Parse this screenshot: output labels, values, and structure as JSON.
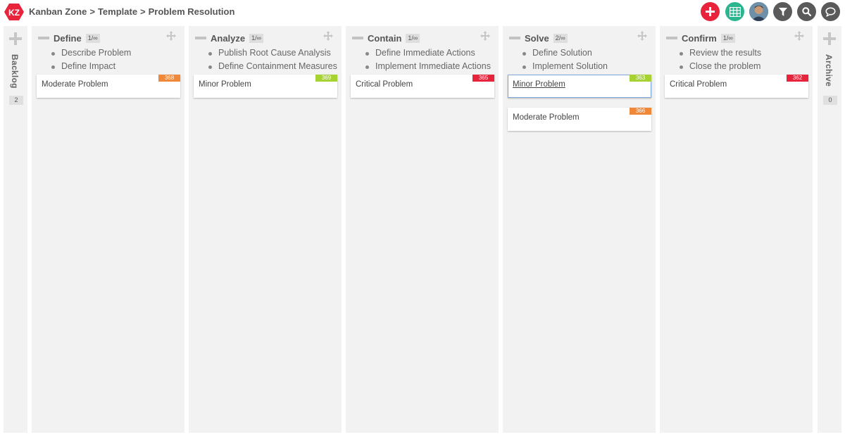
{
  "header": {
    "logo_text": "KZ",
    "breadcrumb": [
      "Kanban Zone",
      "Template",
      "Problem Resolution"
    ],
    "separator": ">",
    "buttons": [
      {
        "name": "add-card-button",
        "icon": "plus-icon",
        "color": "#e8243c"
      },
      {
        "name": "table-view-button",
        "icon": "grid-icon",
        "color": "#2bb58f"
      },
      {
        "name": "user-avatar-button",
        "icon": "avatar",
        "color": "#3a5d7a"
      },
      {
        "name": "filter-button",
        "icon": "filter-icon",
        "color": "#5a5a5a"
      },
      {
        "name": "search-button",
        "icon": "search-icon",
        "color": "#5a5a5a"
      },
      {
        "name": "chat-button",
        "icon": "chat-icon",
        "color": "#5a5a5a"
      }
    ]
  },
  "backlog": {
    "label": "Backlog",
    "count": "2"
  },
  "archive": {
    "label": "Archive",
    "count": "0"
  },
  "columns": [
    {
      "title": "Define",
      "wip": "1/∞",
      "criteria": [
        "Describe Problem",
        "Define Impact"
      ],
      "cards": [
        {
          "title": "Moderate Problem",
          "id": "368",
          "color": "#f0883a",
          "selected": false
        }
      ]
    },
    {
      "title": "Analyze",
      "wip": "1/∞",
      "criteria": [
        "Publish Root Cause Analysis",
        "Define Containment Measures"
      ],
      "cards": [
        {
          "title": "Minor Problem",
          "id": "369",
          "color": "#a7d234",
          "selected": false
        }
      ]
    },
    {
      "title": "Contain",
      "wip": "1/∞",
      "criteria": [
        "Define Immediate Actions",
        "Implement Immediate Actions"
      ],
      "cards": [
        {
          "title": "Critical Problem",
          "id": "365",
          "color": "#e8243c",
          "selected": false
        }
      ]
    },
    {
      "title": "Solve",
      "wip": "2/∞",
      "criteria": [
        "Define Solution",
        "Implement Solution"
      ],
      "cards": [
        {
          "title": "Minor Problem",
          "id": "363",
          "color": "#a7d234",
          "selected": true
        },
        {
          "title": "Moderate Problem",
          "id": "366",
          "color": "#f0883a",
          "selected": false
        }
      ]
    },
    {
      "title": "Confirm",
      "wip": "1/∞",
      "criteria": [
        "Review the results",
        "Close the problem"
      ],
      "cards": [
        {
          "title": "Critical Problem",
          "id": "362",
          "color": "#e8243c",
          "selected": false
        }
      ]
    }
  ]
}
